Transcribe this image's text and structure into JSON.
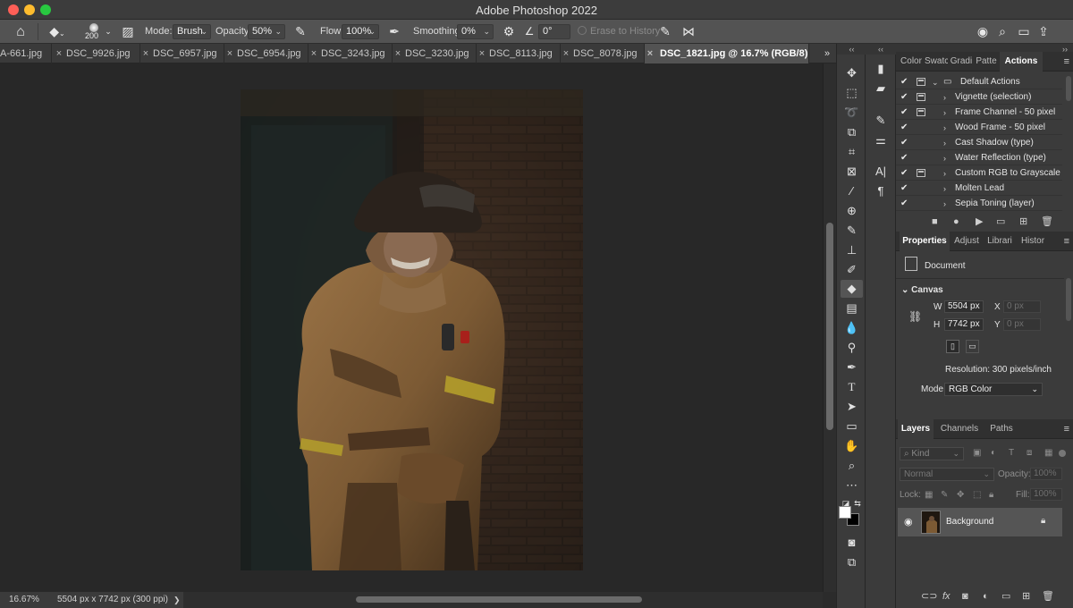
{
  "window": {
    "title": "Adobe Photoshop 2022"
  },
  "options_bar": {
    "brush_size": "200",
    "mode_label": "Mode:",
    "mode_value": "Brush",
    "opacity_label": "Opacity:",
    "opacity_value": "50%",
    "flow_label": "Flow:",
    "flow_value": "100%",
    "smoothing_label": "Smoothing:",
    "smoothing_value": "0%",
    "angle_value": "0°",
    "erase_history_label": "Erase to History"
  },
  "tabs": [
    {
      "name": "A-661.jpg"
    },
    {
      "name": "DSC_9926.jpg"
    },
    {
      "name": "DSC_6957.jpg"
    },
    {
      "name": "DSC_6954.jpg"
    },
    {
      "name": "DSC_3243.jpg"
    },
    {
      "name": "DSC_3230.jpg"
    },
    {
      "name": "DSC_8113.jpg"
    },
    {
      "name": "DSC_8078.jpg"
    },
    {
      "name": "DSC_1821.jpg @ 16.7% (RGB/8) *"
    }
  ],
  "tabs_more": "»",
  "status_bar": {
    "zoom": "16.67%",
    "doc_info": "5504 px x 7742 px (300 ppi)",
    "arrow": "❯"
  },
  "panel_groups": {
    "top_tabs": [
      "Color",
      "Swatc",
      "Gradi",
      "Patte",
      "Actions"
    ],
    "actions": {
      "set_name": "Default Actions",
      "items": [
        {
          "label": "Vignette (selection)",
          "dialog": true
        },
        {
          "label": "Frame Channel - 50 pixel",
          "dialog": true
        },
        {
          "label": "Wood Frame - 50 pixel",
          "dialog": false
        },
        {
          "label": "Cast Shadow (type)",
          "dialog": false
        },
        {
          "label": "Water Reflection (type)",
          "dialog": false
        },
        {
          "label": "Custom RGB to Grayscale",
          "dialog": true
        },
        {
          "label": "Molten Lead",
          "dialog": false
        },
        {
          "label": "Sepia Toning (layer)",
          "dialog": false
        }
      ]
    },
    "mid_tabs": [
      "Properties",
      "Adjust",
      "Librari",
      "Histor"
    ],
    "properties": {
      "document_label": "Document",
      "canvas_label": "Canvas",
      "w_label": "W",
      "w_value": "5504 px",
      "h_label": "H",
      "h_value": "7742 px",
      "x_label": "X",
      "x_placeholder": "0 px",
      "y_label": "Y",
      "y_placeholder": "0 px",
      "resolution": "Resolution: 300 pixels/inch",
      "mode_label": "Mode",
      "mode_value": "RGB Color"
    },
    "layer_tabs": [
      "Layers",
      "Channels",
      "Paths"
    ],
    "layers": {
      "kind_label": "Kind",
      "blend_mode": "Normal",
      "opacity_label": "Opacity:",
      "opacity_value": "100%",
      "lock_label": "Lock:",
      "fill_label": "Fill:",
      "fill_value": "100%",
      "items": [
        {
          "name": "Background",
          "visible": true,
          "locked": true
        }
      ]
    }
  }
}
